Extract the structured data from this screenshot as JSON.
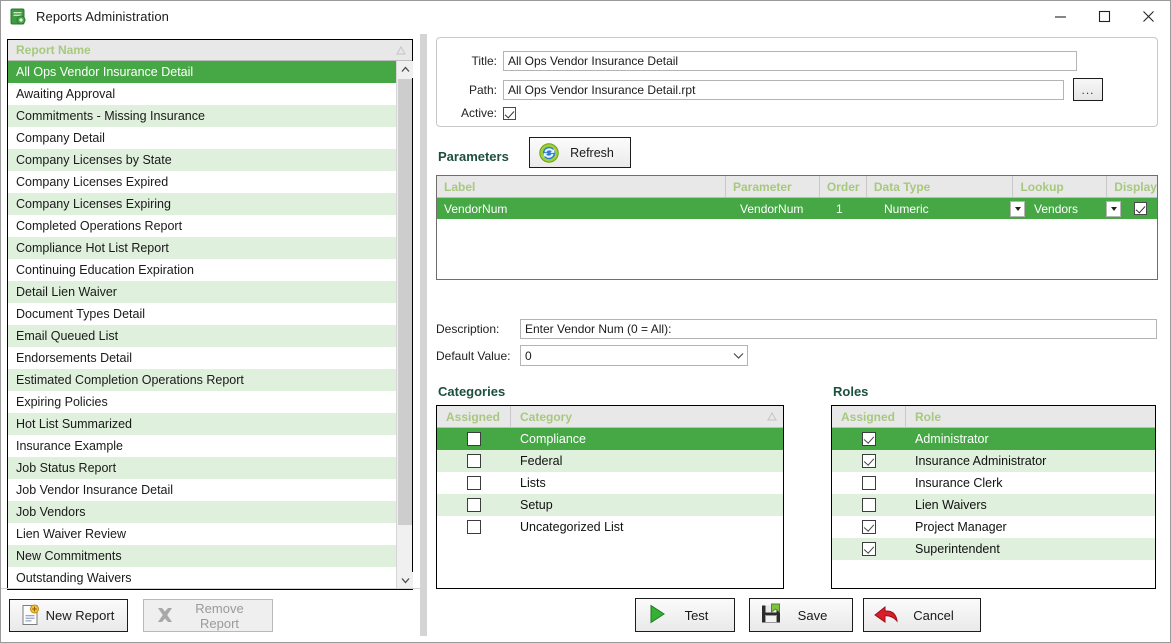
{
  "window": {
    "title": "Reports Administration",
    "icon": "report-app-icon",
    "controls": {
      "minimize": "minimize-icon",
      "maximize": "maximize-icon",
      "close": "close-icon"
    }
  },
  "report_list": {
    "header": "Report  Name",
    "sort_indicator": "sort-ascending-icon",
    "selected_index": 0,
    "items": [
      "All Ops Vendor Insurance Detail",
      "Awaiting Approval",
      "Commitments - Missing Insurance",
      "Company Detail",
      "Company Licenses by State",
      "Company Licenses Expired",
      "Company Licenses Expiring",
      "Completed Operations Report",
      "Compliance Hot List Report",
      "Continuing Education Expiration",
      "Detail Lien Waiver",
      "Document Types Detail",
      "Email Queued List",
      "Endorsements Detail",
      "Estimated Completion Operations Report",
      "Expiring Policies",
      "Hot List Summarized",
      "Insurance Example",
      "Job Status Report",
      "Job Vendor Insurance Detail",
      "Job Vendors",
      "Lien Waiver Review",
      "New Commitments",
      "Outstanding Waivers"
    ]
  },
  "detail_form": {
    "title_label": "Title:",
    "title_value": "All Ops Vendor Insurance Detail",
    "path_label": "Path:",
    "path_value": "All Ops Vendor Insurance Detail.rpt",
    "browse_label": "...",
    "active_label": "Active:",
    "active_checked": true
  },
  "parameters": {
    "section_label": "Parameters",
    "refresh_label": "Refresh",
    "columns": [
      "Label",
      "Parameter",
      "Order",
      "Data Type",
      "Lookup",
      "Display"
    ],
    "rows": [
      {
        "label": "VendorNum",
        "parameter": "VendorNum",
        "order": "1",
        "data_type": "Numeric",
        "lookup": "Vendors",
        "display": true,
        "selected": true
      }
    ],
    "description_label": "Description:",
    "description_value": "Enter Vendor Num (0 = All):",
    "default_value_label": "Default Value:",
    "default_value": "0"
  },
  "categories": {
    "section_label": "Categories",
    "columns": [
      "Assigned",
      "Category"
    ],
    "sort_indicator": "sort-ascending-icon",
    "rows": [
      {
        "assigned": false,
        "name": "Compliance",
        "selected": true
      },
      {
        "assigned": false,
        "name": "Federal",
        "selected": false
      },
      {
        "assigned": false,
        "name": "Lists",
        "selected": false
      },
      {
        "assigned": false,
        "name": "Setup",
        "selected": false
      },
      {
        "assigned": false,
        "name": "Uncategorized List",
        "selected": false
      }
    ]
  },
  "roles": {
    "section_label": "Roles",
    "columns": [
      "Assigned",
      "Role"
    ],
    "rows": [
      {
        "assigned": true,
        "name": "Administrator",
        "selected": true
      },
      {
        "assigned": true,
        "name": "Insurance Administrator",
        "selected": false
      },
      {
        "assigned": false,
        "name": "Insurance Clerk",
        "selected": false
      },
      {
        "assigned": false,
        "name": "Lien Waivers",
        "selected": false
      },
      {
        "assigned": true,
        "name": "Project Manager",
        "selected": false
      },
      {
        "assigned": true,
        "name": "Superintendent",
        "selected": false
      }
    ]
  },
  "buttons": {
    "new_report": "New Report",
    "remove_report": "Remove Report",
    "remove_report_disabled": true,
    "test": "Test",
    "save": "Save",
    "cancel": "Cancel"
  },
  "colors": {
    "selection_green": "#45a845",
    "alt_row_green": "#dff0dc",
    "header_gray": "#e8e8e8",
    "header_text_green": "#a7c97f",
    "section_label": "#1d4f3f"
  }
}
